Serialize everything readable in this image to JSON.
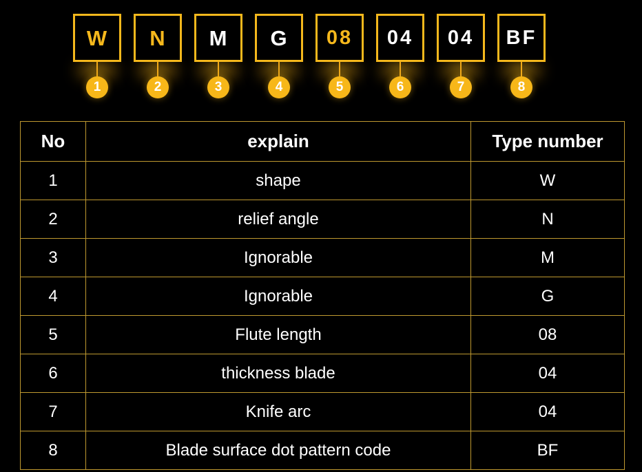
{
  "background_color": "#000000",
  "accent_color": "#F5B81C",
  "table_border_color": "#C09A30",
  "code_strip": {
    "full_code": "WNMG 08 04 04 BF",
    "segments": [
      {
        "index": "1",
        "char": "W",
        "color": "#F5B81C"
      },
      {
        "index": "2",
        "char": "N",
        "color": "#F5B81C"
      },
      {
        "index": "3",
        "char": "M",
        "color": "#FFFFFF"
      },
      {
        "index": "4",
        "char": "G",
        "color": "#FFFFFF"
      },
      {
        "index": "5",
        "char": "08",
        "color": "#F5B81C"
      },
      {
        "index": "6",
        "char": "04",
        "color": "#FFFFFF"
      },
      {
        "index": "7",
        "char": "04",
        "color": "#FFFFFF"
      },
      {
        "index": "8",
        "char": "BF",
        "color": "#FFFFFF"
      }
    ]
  },
  "table": {
    "headers": [
      "No",
      "explain",
      "Type number"
    ],
    "rows": [
      {
        "no": "1",
        "explain": "shape",
        "type_number": "W"
      },
      {
        "no": "2",
        "explain": "relief angle",
        "type_number": "N"
      },
      {
        "no": "3",
        "explain": "Ignorable",
        "type_number": "M"
      },
      {
        "no": "4",
        "explain": "Ignorable",
        "type_number": "G"
      },
      {
        "no": "5",
        "explain": "Flute length",
        "type_number": "08"
      },
      {
        "no": "6",
        "explain": "thickness blade",
        "type_number": "04"
      },
      {
        "no": "7",
        "explain": "Knife arc",
        "type_number": "04"
      },
      {
        "no": "8",
        "explain": "Blade surface dot pattern code",
        "type_number": "BF"
      }
    ]
  }
}
